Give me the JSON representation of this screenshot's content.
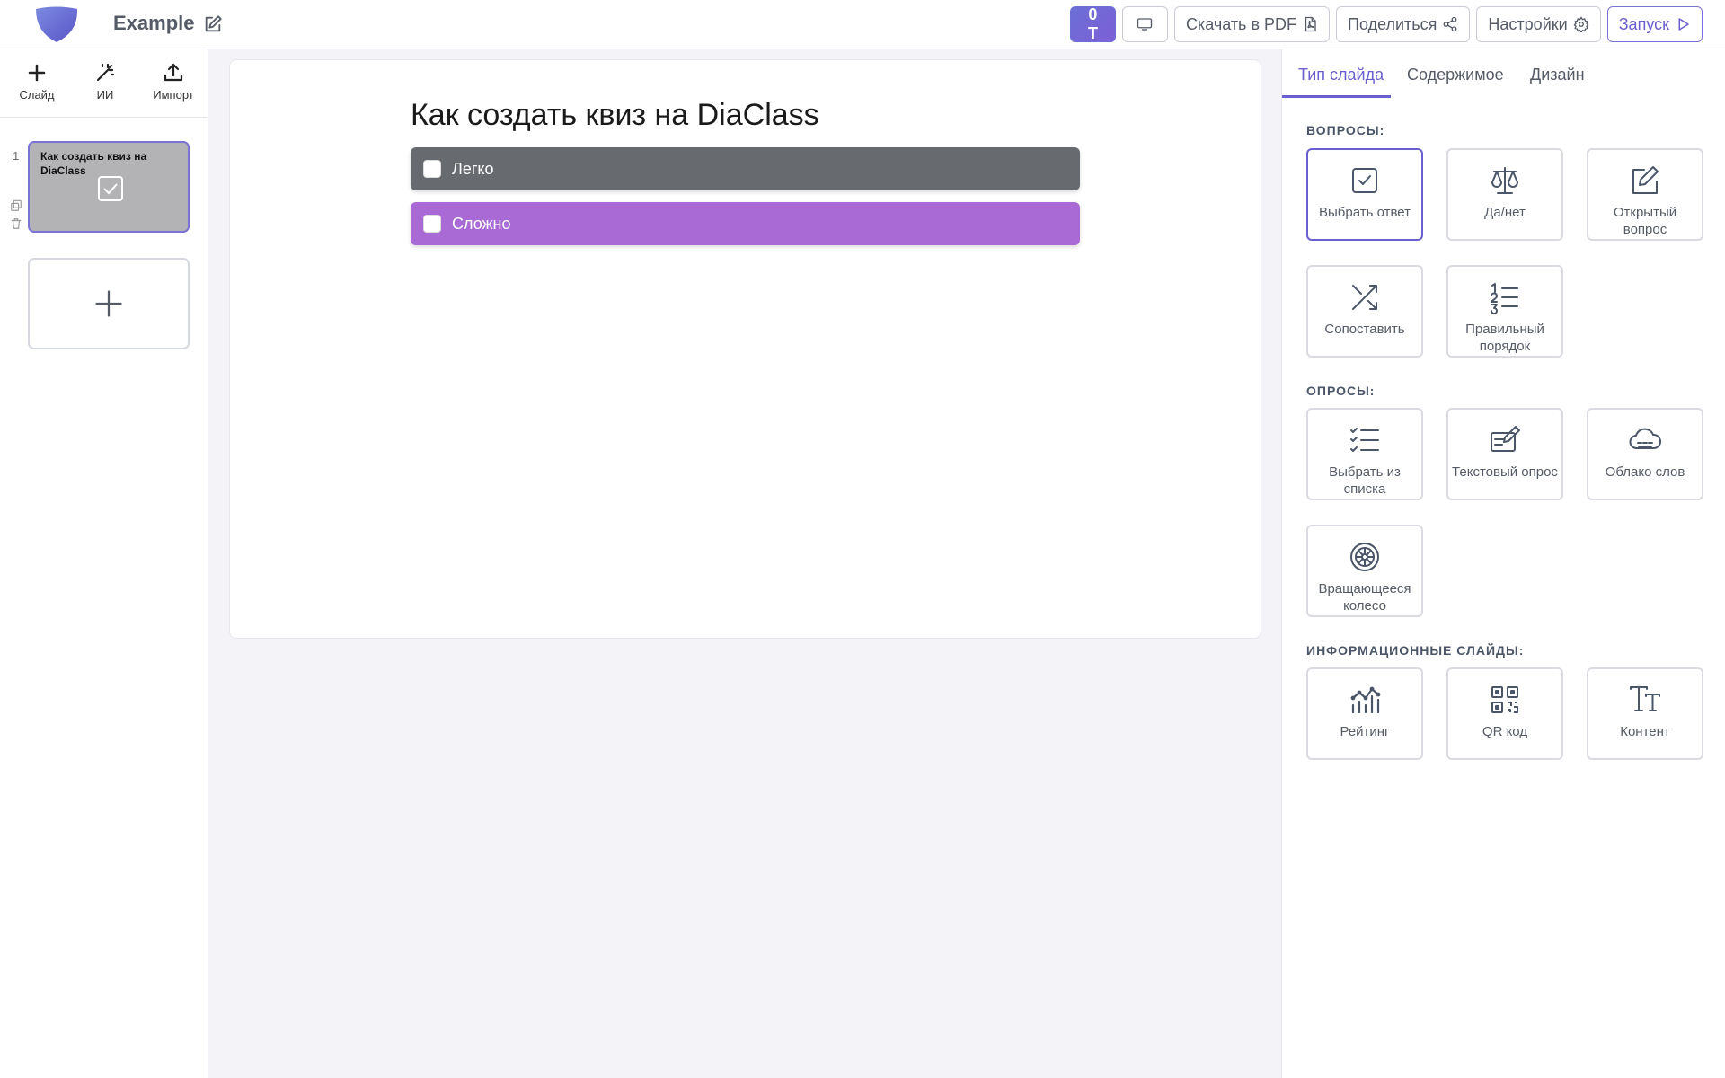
{
  "header": {
    "title": "Example",
    "points_label": "0 T",
    "pdf_label": "Скачать в PDF",
    "share_label": "Поделиться",
    "settings_label": "Настройки",
    "launch_label": "Запуск"
  },
  "toolbar": {
    "slide_label": "Слайд",
    "ai_label": "ИИ",
    "import_label": "Импорт"
  },
  "slides": [
    {
      "number": "1",
      "title": "Как создать квиз на DiaClass"
    }
  ],
  "slide": {
    "heading": "Как создать квиз на DiaClass",
    "answers": [
      {
        "text": "Легко",
        "color": "#676a6f"
      },
      {
        "text": "Сложно",
        "color": "#a96ad6"
      }
    ]
  },
  "panel": {
    "tabs": [
      "Тип слайда",
      "Содержимое",
      "Дизайн"
    ],
    "active_tab": "Тип слайда",
    "sections": {
      "questions": "ВОПРОСЫ:",
      "polls": "ОПРОСЫ:",
      "info": "ИНФОРМАЦИОННЫЕ СЛАЙДЫ:"
    },
    "cards": {
      "choose_answer": "Выбрать ответ",
      "yes_no": "Да/нет",
      "open_question": "Открытый вопрос",
      "match": "Сопоставить",
      "correct_order": "Правильный порядок",
      "select_from_list": "Выбрать из списка",
      "text_poll": "Текстовый опрос",
      "word_cloud": "Облако слов",
      "spinning_wheel": "Вращающееся колесо",
      "rating": "Рейтинг",
      "qr_code": "QR код",
      "content": "Контент"
    }
  },
  "colors": {
    "accent": "#6a5fd0",
    "answer_gray": "#676a6f",
    "answer_purple": "#a96ad6",
    "thumb_bg": "#b3b3b5"
  }
}
